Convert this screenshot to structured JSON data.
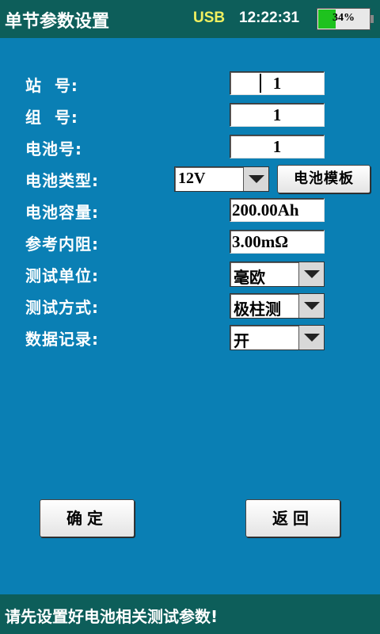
{
  "header": {
    "title": "单节参数设置",
    "usb": "USB",
    "time": "12:22:31",
    "battery": {
      "percent_text": "34%",
      "level": 0.34,
      "fill_color": "#1ec21e"
    }
  },
  "form": {
    "station": {
      "label": "站  号:",
      "value": "1"
    },
    "group": {
      "label": "组  号:",
      "value": "1"
    },
    "cell_no": {
      "label": "电池号:",
      "value": "1"
    },
    "battery_type": {
      "label": "电池类型:",
      "value": "12V",
      "template_button": "电池模板"
    },
    "capacity": {
      "label": "电池容量:",
      "value": "200.00Ah"
    },
    "resistance": {
      "label": "参考内阻:",
      "value": "3.00mΩ"
    },
    "unit": {
      "label": "测试单位:",
      "value": "毫欧"
    },
    "method": {
      "label": "测试方式:",
      "value": "极柱测"
    },
    "record": {
      "label": "数据记录:",
      "value": "开"
    }
  },
  "buttons": {
    "confirm": "确定",
    "back": "返回"
  },
  "status": {
    "message": "请先设置好电池相关测试参数!"
  },
  "colors": {
    "background": "#0a7fb4",
    "bar": "#0d5e5a",
    "usb": "#f0f060"
  }
}
